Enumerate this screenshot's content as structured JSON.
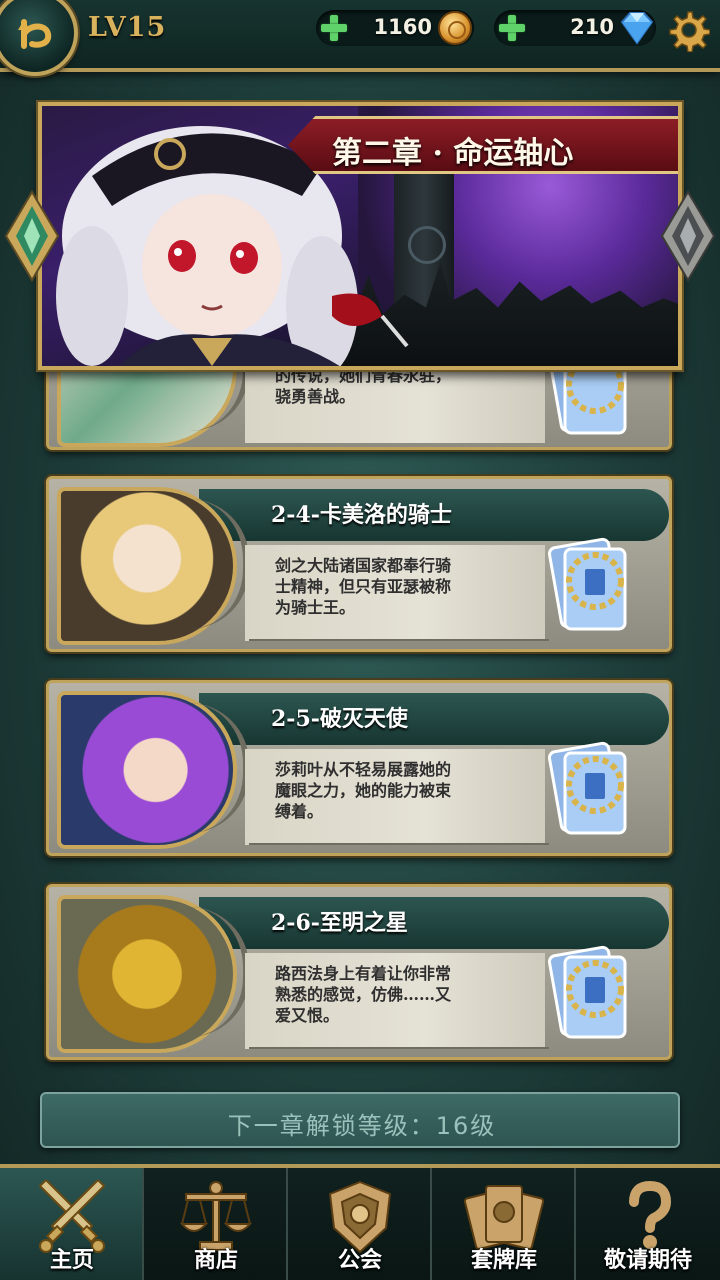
{
  "header": {
    "level": "LV15",
    "gold": "1160",
    "diamonds": "210",
    "back_icon": "back-arrow-icon",
    "settings_icon": "gear-icon"
  },
  "chapter": {
    "title": "第二章 · 命运轴心"
  },
  "stages": [
    {
      "title": "",
      "description": "的传说，她们青春永驻，\n骁勇善战。"
    },
    {
      "title": "2-4-卡美洛的骑士",
      "description": "剑之大陆诸国家都奉行骑\n士精神，但只有亚瑟被称\n为骑士王。"
    },
    {
      "title": "2-5-破灭天使",
      "description": "莎莉叶从不轻易展露她的\n魔眼之力，她的能力被束\n缚着。"
    },
    {
      "title": "2-6-至明之星",
      "description": "路西法身上有着让你非常\n熟悉的感觉，仿佛……又\n爱又恨。"
    }
  ],
  "unlock_text": "下一章解锁等级：16级",
  "nav": [
    {
      "label": "主页",
      "icon": "crossed-swords-icon",
      "active": true
    },
    {
      "label": "商店",
      "icon": "scales-icon",
      "active": false
    },
    {
      "label": "公会",
      "icon": "guild-crest-icon",
      "active": false
    },
    {
      "label": "套牌库",
      "icon": "card-deck-icon",
      "active": false
    },
    {
      "label": "敬请期待",
      "icon": "question-mark-icon",
      "active": false
    }
  ],
  "colors": {
    "gold_frame": "#c0a35a",
    "banner_red": "#8d1d26",
    "teal_bg": "#1d3c39",
    "unlock_text": "#9bc1bb"
  }
}
